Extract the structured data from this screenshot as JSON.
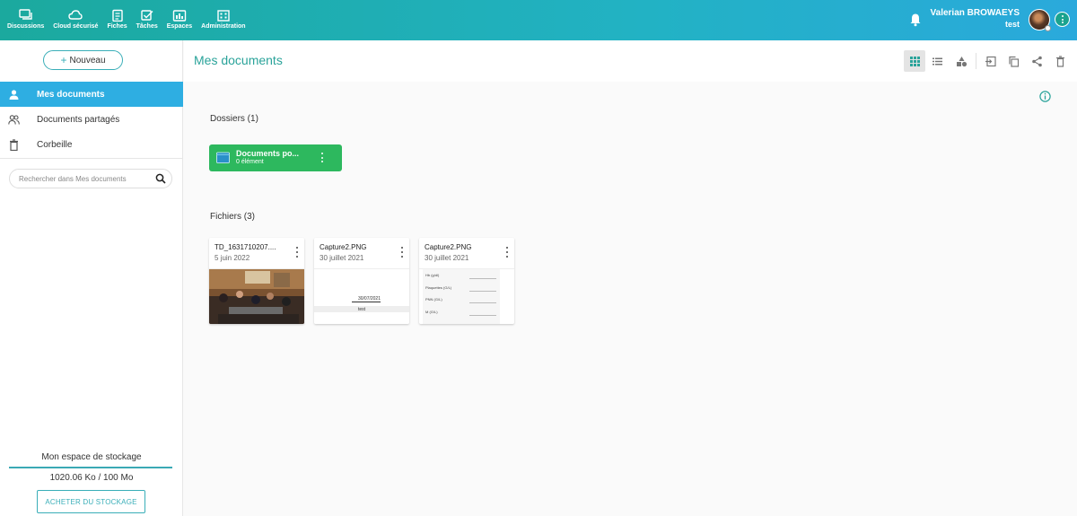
{
  "topbar": {
    "nav": [
      {
        "label": "Discussions",
        "icon": "chat-icon"
      },
      {
        "label": "Cloud sécurisé",
        "icon": "cloud-icon"
      },
      {
        "label": "Fiches",
        "icon": "clipboard-icon"
      },
      {
        "label": "Tâches",
        "icon": "task-check-icon"
      },
      {
        "label": "Espaces",
        "icon": "spaces-icon"
      },
      {
        "label": "Administration",
        "icon": "building-icon"
      }
    ],
    "user_name": "Valerian BROWAEYS",
    "user_sub": "test"
  },
  "sidebar": {
    "new_label": "Nouveau",
    "items": [
      {
        "label": "Mes documents",
        "icon": "person-icon",
        "active": true
      },
      {
        "label": "Documents partagés",
        "icon": "people-icon",
        "active": false
      },
      {
        "label": "Corbeille",
        "icon": "trash-icon",
        "active": false
      }
    ],
    "search_placeholder": "Rechercher dans Mes documents",
    "storage_title": "Mon espace de stockage",
    "storage_value": "1020.06 Ko / 100 Mo",
    "storage_fraction": 1.0,
    "buy_label": "ACHETER DU STOCKAGE"
  },
  "main": {
    "title": "Mes documents",
    "folders_title": "Dossiers (1)",
    "folders": [
      {
        "name": "Documents po...",
        "meta": "0 élément",
        "color": "#2db85e"
      }
    ],
    "files_title": "Fichiers (3)",
    "files": [
      {
        "name": "TD_1631710207....",
        "date": "5 juin 2022",
        "thumb": "photo"
      },
      {
        "name": "Capture2.PNG",
        "date": "30 juillet 2021",
        "thumb": "capture-date"
      },
      {
        "name": "Capture2.PNG",
        "date": "30 juillet 2021",
        "thumb": "capture-form"
      }
    ],
    "thumb_texts": {
      "date_value": "30/07/2021",
      "date_label": "test",
      "form_lines": [
        "Hb (g/dl)",
        "Plaquettes (G/L)",
        "PNN (G/L)",
        "M (G/L)"
      ]
    }
  },
  "colors": {
    "accent": "#2aa39a",
    "active_bg": "#2eaee2",
    "folder": "#2db85e"
  }
}
